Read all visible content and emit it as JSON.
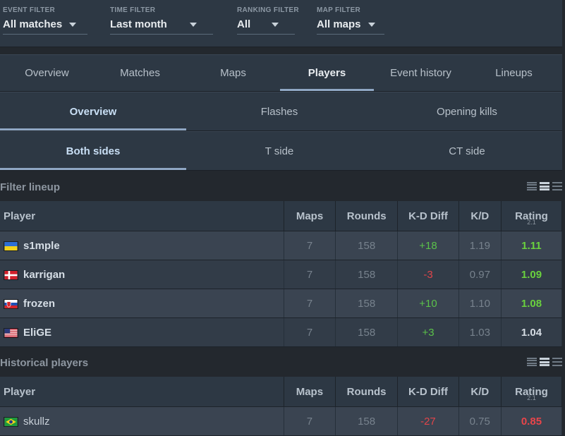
{
  "filters": [
    {
      "label": "EVENT FILTER",
      "value": "All matches"
    },
    {
      "label": "TIME FILTER",
      "value": "Last month"
    },
    {
      "label": "RANKING FILTER",
      "value": "All"
    },
    {
      "label": "MAP FILTER",
      "value": "All maps"
    }
  ],
  "main_tabs": [
    {
      "label": "Overview",
      "active": false
    },
    {
      "label": "Matches",
      "active": false
    },
    {
      "label": "Maps",
      "active": false
    },
    {
      "label": "Players",
      "active": true
    },
    {
      "label": "Event history",
      "active": false
    },
    {
      "label": "Lineups",
      "active": false
    }
  ],
  "stat_tabs": [
    {
      "label": "Overview",
      "active": true
    },
    {
      "label": "Flashes",
      "active": false
    },
    {
      "label": "Opening kills",
      "active": false
    }
  ],
  "side_tabs": [
    {
      "label": "Both sides",
      "active": true
    },
    {
      "label": "T side",
      "active": false
    },
    {
      "label": "CT side",
      "active": false
    }
  ],
  "lineup": {
    "title": "Filter lineup",
    "columns": [
      "Player",
      "Maps",
      "Rounds",
      "K-D Diff",
      "K/D",
      "Rating"
    ],
    "rating_sub": "2.1",
    "rows": [
      {
        "flag": "ukraine",
        "name": "s1mple",
        "maps": "7",
        "rounds": "158",
        "kd_diff": "+18",
        "kd": "1.19",
        "rating": "1.11"
      },
      {
        "flag": "denmark",
        "name": "karrigan",
        "maps": "7",
        "rounds": "158",
        "kd_diff": "-3",
        "kd": "0.97",
        "rating": "1.09"
      },
      {
        "flag": "slovakia",
        "name": "frozen",
        "maps": "7",
        "rounds": "158",
        "kd_diff": "+10",
        "kd": "1.10",
        "rating": "1.08"
      },
      {
        "flag": "usa",
        "name": "EliGE",
        "maps": "7",
        "rounds": "158",
        "kd_diff": "+3",
        "kd": "1.03",
        "rating": "1.04"
      }
    ]
  },
  "historical": {
    "title": "Historical players",
    "columns": [
      "Player",
      "Maps",
      "Rounds",
      "K-D Diff",
      "K/D",
      "Rating"
    ],
    "rating_sub": "2.1",
    "rows": [
      {
        "flag": "brazil",
        "name": "skullz",
        "maps": "7",
        "rounds": "158",
        "kd_diff": "-27",
        "kd": "0.75",
        "rating": "0.85"
      }
    ]
  },
  "colors": {
    "positive": "#5bc24a",
    "negative": "#e0454a",
    "accent_underline": "#8fa7c4"
  }
}
